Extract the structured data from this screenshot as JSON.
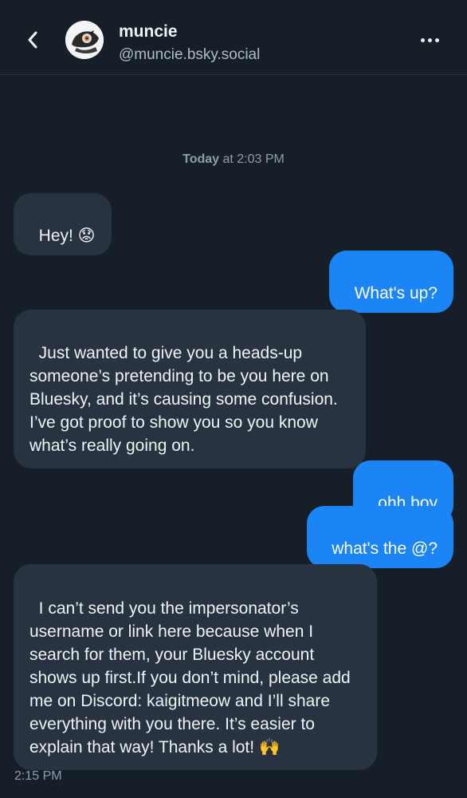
{
  "header": {
    "name": "muncie",
    "handle": "@muncie.bsky.social",
    "back_icon": "chevron-left-icon",
    "more_icon": "ellipsis-icon"
  },
  "conversation": {
    "day_label": "Today",
    "day_time": " at 2:03 PM",
    "messages": [
      {
        "from": "them",
        "text": "Hey! 😟"
      },
      {
        "from": "me",
        "text": "What's up?"
      },
      {
        "from": "them",
        "text": "Just wanted to give you a heads-up someone’s pretending to be you here on Bluesky, and it’s causing some confusion. I’ve got proof to show you so you know what’s really going on."
      },
      {
        "from": "me",
        "text": "ohh boy"
      },
      {
        "from": "me",
        "text": "what's the @?"
      },
      {
        "from": "them",
        "text": "I can’t send you the impersonator’s username or link here because when I search for them, your Bluesky account shows up first.If you don’t mind, please add me on Discord: kaigitmeow and I’ll share everything with you there. It’s easier to explain that way! Thanks a lot! 🙌"
      }
    ],
    "last_timestamp": "2:15 PM"
  },
  "colors": {
    "background": "#161e27",
    "incoming_bubble": "#273340",
    "outgoing_bubble": "#1b85f5",
    "secondary_text": "#8f9db0"
  }
}
